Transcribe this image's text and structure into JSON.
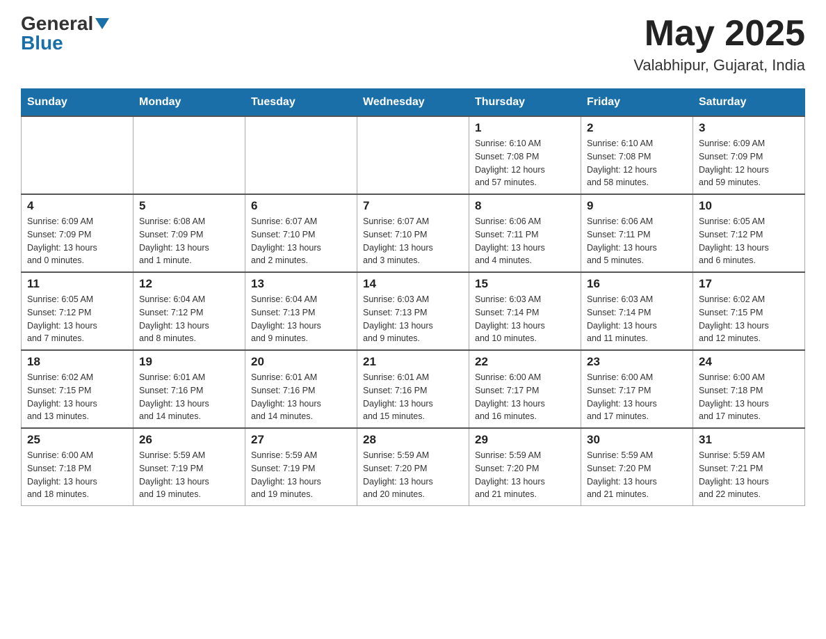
{
  "header": {
    "logo_general": "General",
    "logo_blue": "Blue",
    "month": "May 2025",
    "location": "Valabhipur, Gujarat, India"
  },
  "days_of_week": [
    "Sunday",
    "Monday",
    "Tuesday",
    "Wednesday",
    "Thursday",
    "Friday",
    "Saturday"
  ],
  "weeks": [
    [
      {
        "day": "",
        "info": ""
      },
      {
        "day": "",
        "info": ""
      },
      {
        "day": "",
        "info": ""
      },
      {
        "day": "",
        "info": ""
      },
      {
        "day": "1",
        "info": "Sunrise: 6:10 AM\nSunset: 7:08 PM\nDaylight: 12 hours\nand 57 minutes."
      },
      {
        "day": "2",
        "info": "Sunrise: 6:10 AM\nSunset: 7:08 PM\nDaylight: 12 hours\nand 58 minutes."
      },
      {
        "day": "3",
        "info": "Sunrise: 6:09 AM\nSunset: 7:09 PM\nDaylight: 12 hours\nand 59 minutes."
      }
    ],
    [
      {
        "day": "4",
        "info": "Sunrise: 6:09 AM\nSunset: 7:09 PM\nDaylight: 13 hours\nand 0 minutes."
      },
      {
        "day": "5",
        "info": "Sunrise: 6:08 AM\nSunset: 7:09 PM\nDaylight: 13 hours\nand 1 minute."
      },
      {
        "day": "6",
        "info": "Sunrise: 6:07 AM\nSunset: 7:10 PM\nDaylight: 13 hours\nand 2 minutes."
      },
      {
        "day": "7",
        "info": "Sunrise: 6:07 AM\nSunset: 7:10 PM\nDaylight: 13 hours\nand 3 minutes."
      },
      {
        "day": "8",
        "info": "Sunrise: 6:06 AM\nSunset: 7:11 PM\nDaylight: 13 hours\nand 4 minutes."
      },
      {
        "day": "9",
        "info": "Sunrise: 6:06 AM\nSunset: 7:11 PM\nDaylight: 13 hours\nand 5 minutes."
      },
      {
        "day": "10",
        "info": "Sunrise: 6:05 AM\nSunset: 7:12 PM\nDaylight: 13 hours\nand 6 minutes."
      }
    ],
    [
      {
        "day": "11",
        "info": "Sunrise: 6:05 AM\nSunset: 7:12 PM\nDaylight: 13 hours\nand 7 minutes."
      },
      {
        "day": "12",
        "info": "Sunrise: 6:04 AM\nSunset: 7:12 PM\nDaylight: 13 hours\nand 8 minutes."
      },
      {
        "day": "13",
        "info": "Sunrise: 6:04 AM\nSunset: 7:13 PM\nDaylight: 13 hours\nand 9 minutes."
      },
      {
        "day": "14",
        "info": "Sunrise: 6:03 AM\nSunset: 7:13 PM\nDaylight: 13 hours\nand 9 minutes."
      },
      {
        "day": "15",
        "info": "Sunrise: 6:03 AM\nSunset: 7:14 PM\nDaylight: 13 hours\nand 10 minutes."
      },
      {
        "day": "16",
        "info": "Sunrise: 6:03 AM\nSunset: 7:14 PM\nDaylight: 13 hours\nand 11 minutes."
      },
      {
        "day": "17",
        "info": "Sunrise: 6:02 AM\nSunset: 7:15 PM\nDaylight: 13 hours\nand 12 minutes."
      }
    ],
    [
      {
        "day": "18",
        "info": "Sunrise: 6:02 AM\nSunset: 7:15 PM\nDaylight: 13 hours\nand 13 minutes."
      },
      {
        "day": "19",
        "info": "Sunrise: 6:01 AM\nSunset: 7:16 PM\nDaylight: 13 hours\nand 14 minutes."
      },
      {
        "day": "20",
        "info": "Sunrise: 6:01 AM\nSunset: 7:16 PM\nDaylight: 13 hours\nand 14 minutes."
      },
      {
        "day": "21",
        "info": "Sunrise: 6:01 AM\nSunset: 7:16 PM\nDaylight: 13 hours\nand 15 minutes."
      },
      {
        "day": "22",
        "info": "Sunrise: 6:00 AM\nSunset: 7:17 PM\nDaylight: 13 hours\nand 16 minutes."
      },
      {
        "day": "23",
        "info": "Sunrise: 6:00 AM\nSunset: 7:17 PM\nDaylight: 13 hours\nand 17 minutes."
      },
      {
        "day": "24",
        "info": "Sunrise: 6:00 AM\nSunset: 7:18 PM\nDaylight: 13 hours\nand 17 minutes."
      }
    ],
    [
      {
        "day": "25",
        "info": "Sunrise: 6:00 AM\nSunset: 7:18 PM\nDaylight: 13 hours\nand 18 minutes."
      },
      {
        "day": "26",
        "info": "Sunrise: 5:59 AM\nSunset: 7:19 PM\nDaylight: 13 hours\nand 19 minutes."
      },
      {
        "day": "27",
        "info": "Sunrise: 5:59 AM\nSunset: 7:19 PM\nDaylight: 13 hours\nand 19 minutes."
      },
      {
        "day": "28",
        "info": "Sunrise: 5:59 AM\nSunset: 7:20 PM\nDaylight: 13 hours\nand 20 minutes."
      },
      {
        "day": "29",
        "info": "Sunrise: 5:59 AM\nSunset: 7:20 PM\nDaylight: 13 hours\nand 21 minutes."
      },
      {
        "day": "30",
        "info": "Sunrise: 5:59 AM\nSunset: 7:20 PM\nDaylight: 13 hours\nand 21 minutes."
      },
      {
        "day": "31",
        "info": "Sunrise: 5:59 AM\nSunset: 7:21 PM\nDaylight: 13 hours\nand 22 minutes."
      }
    ]
  ]
}
